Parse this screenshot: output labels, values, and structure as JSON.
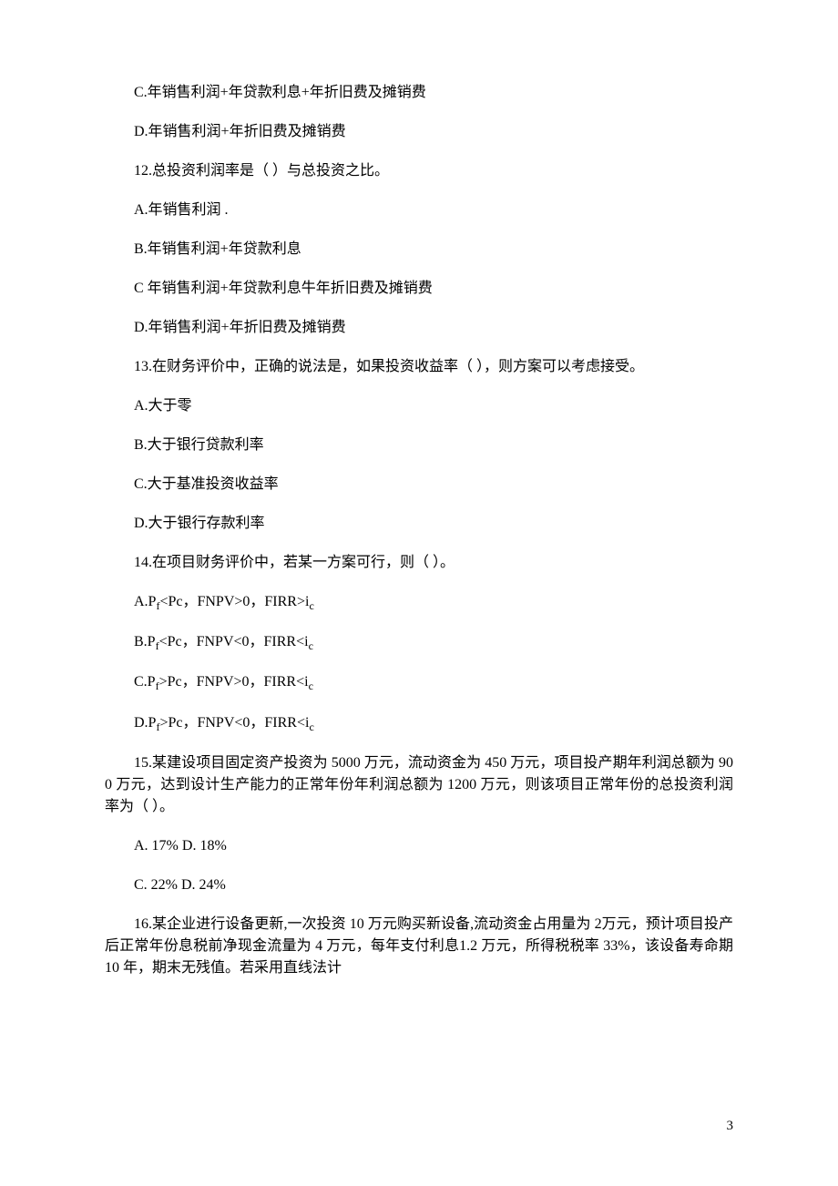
{
  "lines": [
    {
      "text": "C.年销售利润+年贷款利息+年折旧费及摊销费",
      "indent": true
    },
    {
      "text": "D.年销售利润+年折旧费及摊销费",
      "indent": true
    },
    {
      "text": "12.总投资利润率是（ ）与总投资之比。",
      "indent": true
    },
    {
      "text": "A.年销售利润 .",
      "indent": true
    },
    {
      "text": "B.年销售利润+年贷款利息",
      "indent": true
    },
    {
      "text": "C 年销售利润+年贷款利息牛年折旧费及摊销费",
      "indent": true
    },
    {
      "text": "D.年销售利润+年折旧费及摊销费",
      "indent": true
    },
    {
      "text": "13.在财务评价中，正确的说法是，如果投资收益率（ ），则方案可以考虑接受。",
      "indent": true
    },
    {
      "text": "A.大于零",
      "indent": true
    },
    {
      "text": "B.大于银行贷款利率",
      "indent": true
    },
    {
      "text": "C.大于基准投资收益率",
      "indent": true
    },
    {
      "text": "D.大于银行存款利率",
      "indent": true
    },
    {
      "text": "14.在项目财务评价中，若某一方案可行，则（ ）。",
      "indent": true
    },
    {
      "html": "A.P<span class='sub'>f</span>&lt;Pc，FNPV&gt;0，FIRR&gt;i<span class='sub'>c</span>",
      "indent": true
    },
    {
      "html": "B.P<span class='sub'>f</span>&lt;Pc，FNPV&lt;0，FIRR&lt;i<span class='sub'>c</span>",
      "indent": true
    },
    {
      "html": "C.P<span class='sub'>f</span>&gt;Pc，FNPV&gt;0，FIRR&lt;i<span class='sub'>c</span>",
      "indent": true
    },
    {
      "html": "D.P<span class='sub'>f</span>&gt;Pc，FNPV&lt;0，FIRR&lt;i<span class='sub'>c</span>",
      "indent": true
    },
    {
      "text": "15.某建设项目固定资产投资为 5000 万元，流动资金为 450 万元，项目投产期年利润总额为 900 万元，达到设计生产能力的正常年份年利润总额为 1200 万元，则该项目正常年份的总投资利润率为（ ）。",
      "indent": true
    },
    {
      "text": "A. 17%  D. 18%",
      "indent": true
    },
    {
      "text": "C. 22%  D. 24%",
      "indent": true
    },
    {
      "text": "16.某企业进行设备更新,一次投资 10 万元购买新设备,流动资金占用量为 2万元，预计项目投产后正常年份息税前净现金流量为 4 万元，每年支付利息1.2 万元，所得税税率 33%，该设备寿命期 10 年，期末无残值。若采用直线法计",
      "indent": true
    }
  ],
  "page_number": "3"
}
